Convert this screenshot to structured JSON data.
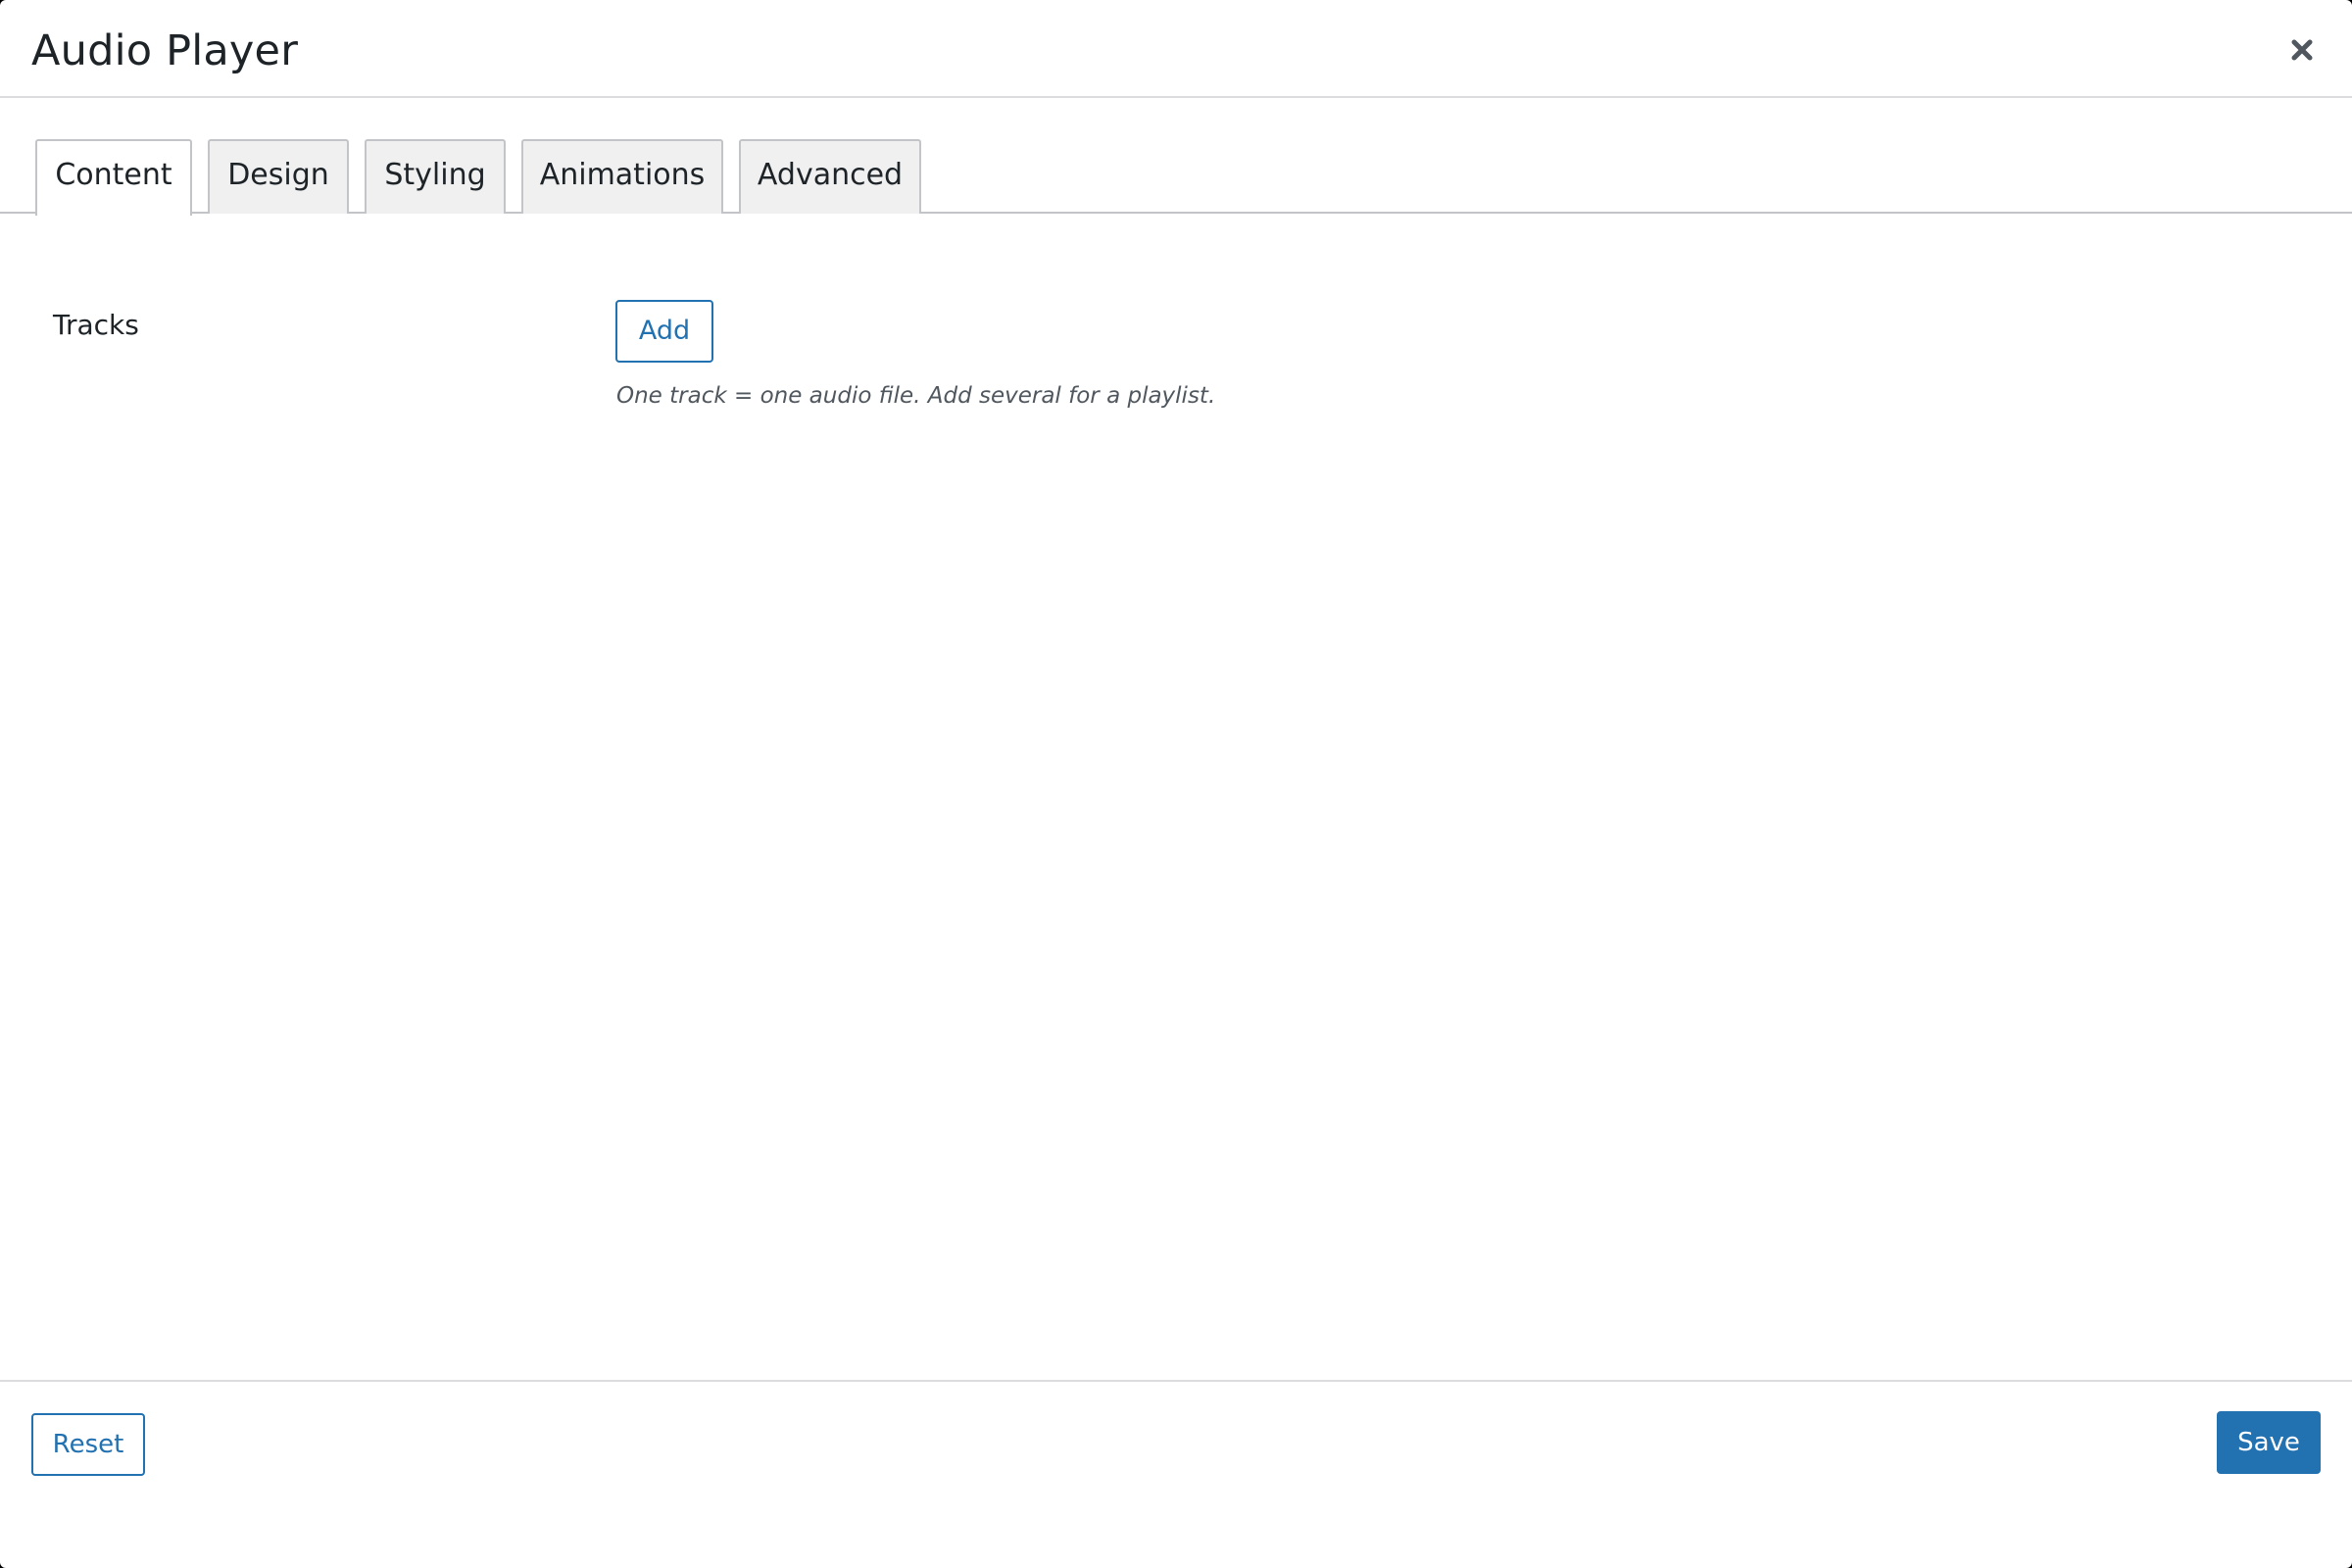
{
  "modal": {
    "title": "Audio Player",
    "close_icon": "close-icon"
  },
  "tabs": [
    {
      "label": "Content",
      "active": true
    },
    {
      "label": "Design",
      "active": false
    },
    {
      "label": "Styling",
      "active": false
    },
    {
      "label": "Animations",
      "active": false
    },
    {
      "label": "Advanced",
      "active": false
    }
  ],
  "content": {
    "tracks_label": "Tracks",
    "add_label": "Add",
    "help_text": "One track = one audio file. Add several for a playlist."
  },
  "footer": {
    "reset_label": "Reset",
    "save_label": "Save"
  },
  "colors": {
    "accent": "#2271b1",
    "text": "#1d2327",
    "border": "#c3c4c7",
    "tab_inactive_bg": "#f0f0f1"
  }
}
